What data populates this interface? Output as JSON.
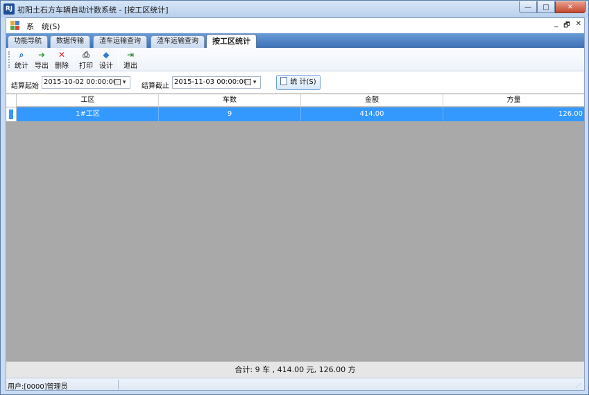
{
  "window": {
    "logo_text": "RJ",
    "title": "初阳土石方车辆自动计数系统 - [按工区统计]",
    "controls": {
      "minimize": "—",
      "maximize": "□",
      "close": "✕"
    }
  },
  "menubar": {
    "items": [
      {
        "label": "系"
      },
      {
        "label": "统(S)"
      }
    ],
    "mdi_controls": {
      "minimize": "_",
      "restore": "🗗",
      "close": "✕"
    }
  },
  "tabs": [
    {
      "label": "功能导航",
      "active": false
    },
    {
      "label": "数据传输",
      "active": false
    },
    {
      "label": "渣车运输查询",
      "active": false
    },
    {
      "label": "渣车运输查询",
      "active": false
    },
    {
      "label": "按工区统计",
      "active": true
    }
  ],
  "toolbar": {
    "buttons": [
      {
        "label": "统计",
        "icon": "magnifier-icon",
        "glyph": "⌕",
        "color": "#2a6fc0"
      },
      {
        "label": "导出",
        "icon": "export-icon",
        "glyph": "➜",
        "color": "#2e9a3a"
      },
      {
        "label": "删除",
        "icon": "delete-icon",
        "glyph": "✕",
        "color": "#d42020"
      },
      {
        "label": "打印",
        "icon": "printer-icon",
        "glyph": "⎙",
        "color": "#555555"
      },
      {
        "label": "设计",
        "icon": "design-icon",
        "glyph": "◆",
        "color": "#2f7fd0"
      },
      {
        "label": "退出",
        "icon": "exit-icon",
        "glyph": "⇥",
        "color": "#2e8a3a"
      }
    ]
  },
  "filter": {
    "start_label": "结算起始",
    "start_value": "2015-10-02 00:00:00",
    "end_label": "结算截止",
    "end_value": "2015-11-03 00:00:00",
    "stat_button": "统 计(S)"
  },
  "grid": {
    "columns": [
      "工区",
      "车数",
      "金额",
      "方量"
    ],
    "rows": [
      {
        "zone": "1#工区",
        "count": "9",
        "amount": "414.00",
        "volume": "126.00"
      }
    ]
  },
  "summary": "合计: 9 车 , 414.00 元, 126.00 方",
  "status": {
    "user": "用户:[0000]管理员"
  },
  "colors": {
    "selection": "#3399ff",
    "tab_strip": "#4a80c4",
    "grid_bg": "#a9a9a9"
  }
}
